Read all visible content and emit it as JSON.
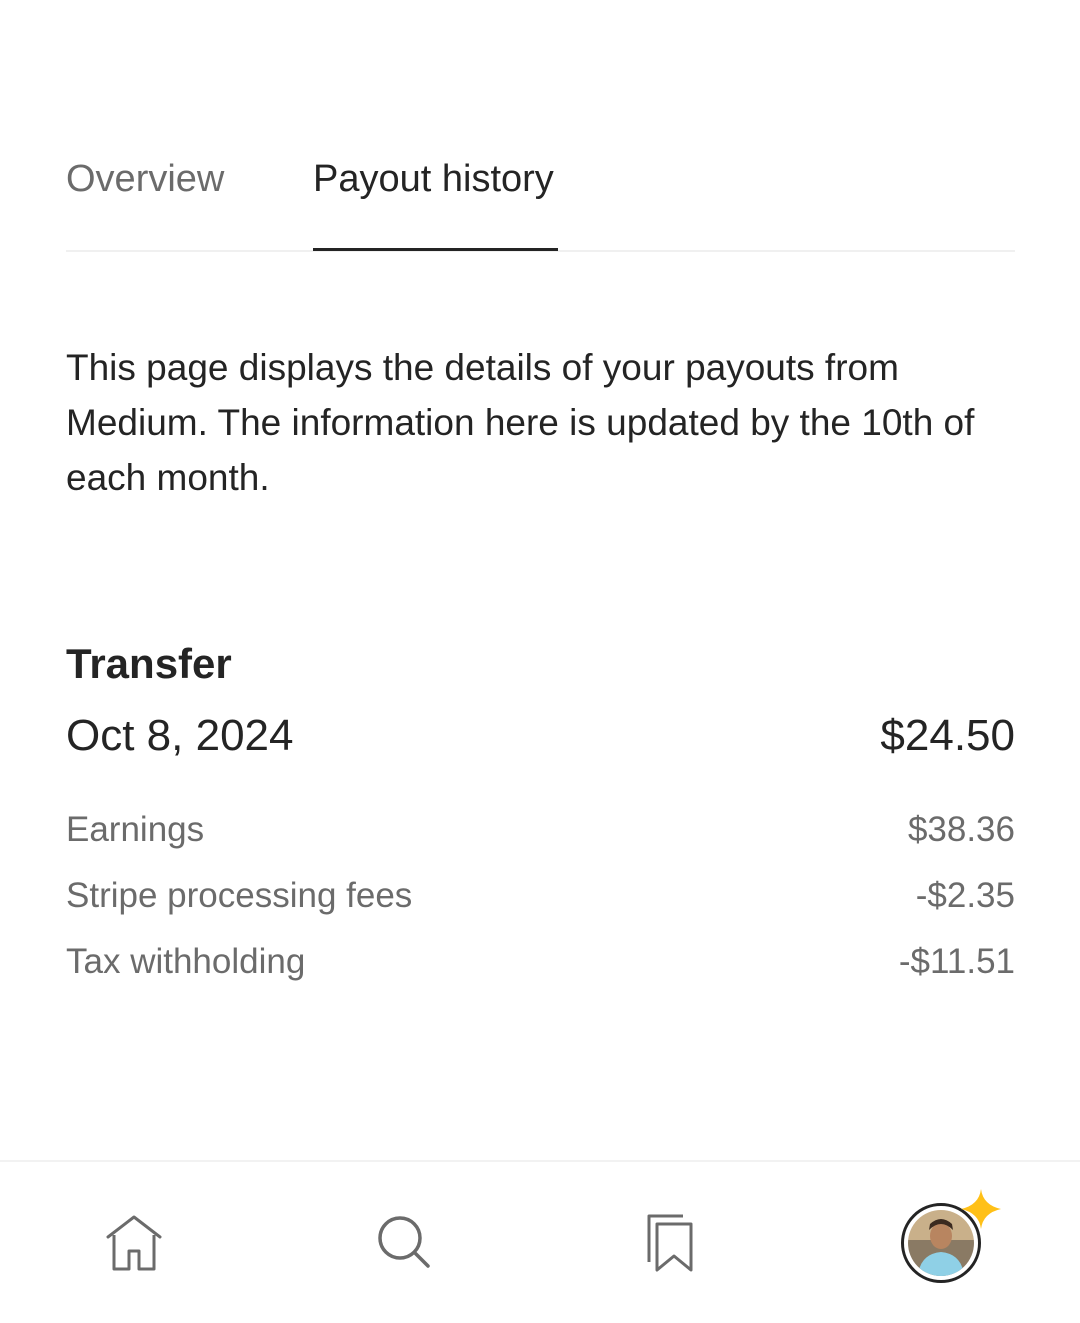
{
  "tabs": [
    {
      "label": "Overview",
      "active": false
    },
    {
      "label": "Payout history",
      "active": true
    }
  ],
  "intro_text": "This page displays the details of your payouts from Medium. The information here is updated by the 10th of each month.",
  "transfer": {
    "heading": "Transfer",
    "date": "Oct 8, 2024",
    "amount": "$24.50",
    "line_items": [
      {
        "label": "Earnings",
        "value": "$38.36"
      },
      {
        "label": "Stripe processing fees",
        "value": "-$2.35"
      },
      {
        "label": "Tax withholding",
        "value": "-$11.51"
      }
    ]
  },
  "bottom_nav": {
    "items": [
      {
        "icon": "home-icon"
      },
      {
        "icon": "search-icon"
      },
      {
        "icon": "bookmarks-icon"
      },
      {
        "icon": "avatar"
      }
    ]
  },
  "colors": {
    "text_primary": "#242424",
    "text_secondary": "#6b6b6b",
    "sparkle": "#ffc017",
    "divider": "#f0f0f0"
  }
}
